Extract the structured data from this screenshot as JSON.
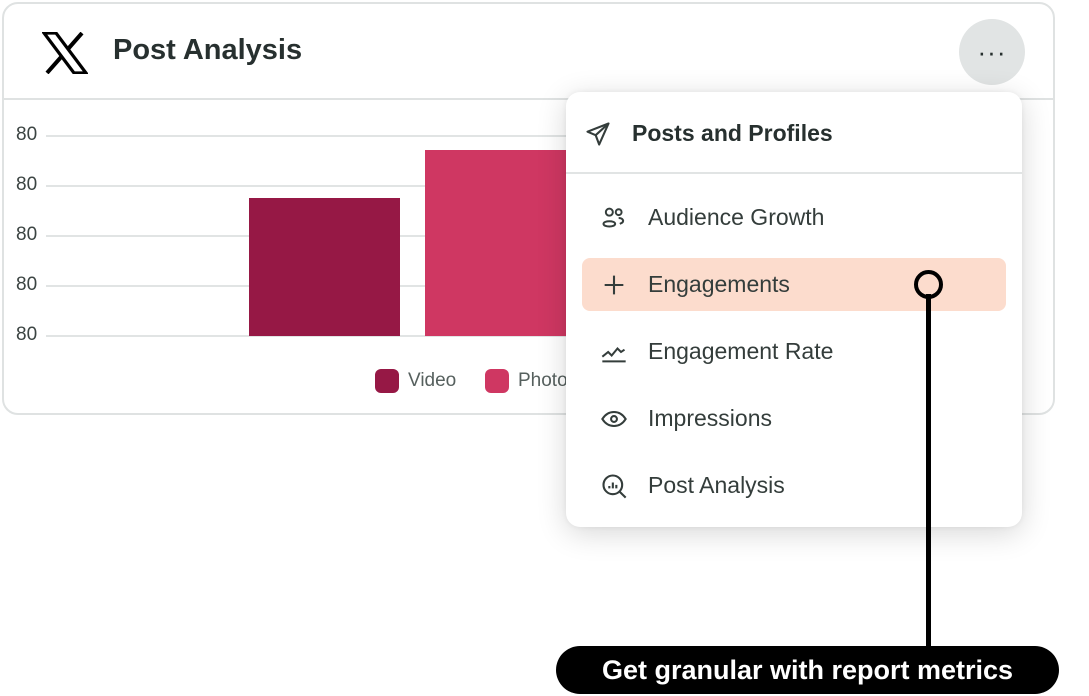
{
  "card": {
    "title": "Post Analysis",
    "logo": "x-logo",
    "more_icon": "ellipsis-icon",
    "more_label": "···"
  },
  "chart_data": {
    "type": "bar",
    "y_tick_labels": [
      "80",
      "80",
      "80",
      "80",
      "80"
    ],
    "categories": [
      "Video",
      "Photo"
    ],
    "series": [
      {
        "name": "Video",
        "color": "#961845",
        "value_fraction_of_axis": 0.69
      },
      {
        "name": "Photo",
        "color": "#cf3762",
        "value_fraction_of_axis": 0.93
      }
    ],
    "grid": true,
    "legend_placement": "bottom"
  },
  "menu": {
    "header": {
      "label": "Posts and Profiles",
      "icon": "paper-plane-icon"
    },
    "items": [
      {
        "label": "Audience Growth",
        "icon": "users-icon",
        "active": false
      },
      {
        "label": "Engagements",
        "icon": "plus-icon",
        "active": true
      },
      {
        "label": "Engagement Rate",
        "icon": "line-chart-icon",
        "active": false
      },
      {
        "label": "Impressions",
        "icon": "eye-icon",
        "active": false
      },
      {
        "label": "Post Analysis",
        "icon": "search-chart-icon",
        "active": false
      }
    ],
    "active_color": "#fcdccd"
  },
  "callout": {
    "text": "Get granular with report metrics"
  }
}
